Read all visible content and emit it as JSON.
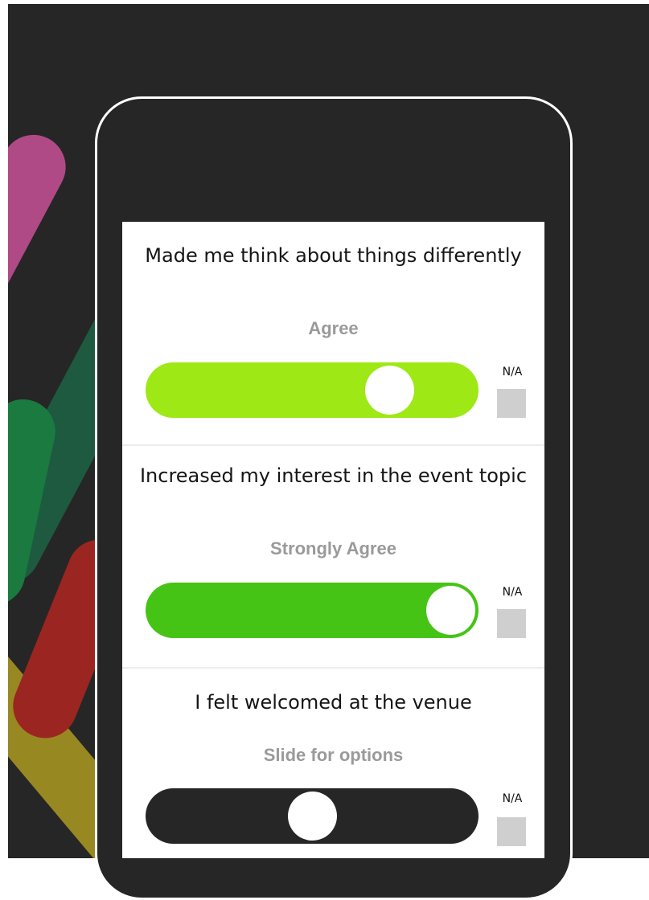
{
  "colors": {
    "background": "#262626",
    "phone_outline": "#ffffff",
    "slider_agree": "#9ee815",
    "slider_strongly_agree": "#45c416",
    "slider_neutral": "#262626",
    "na_box": "#cfcfcf",
    "answer_text": "#9a9a9a"
  },
  "survey": {
    "questions": [
      {
        "question": "Made me think about things differently",
        "answer": "Agree",
        "slider_level": 0.78,
        "na_label": "N/A",
        "na_checked": false
      },
      {
        "question": "Increased my interest in the event topic",
        "answer": "Strongly Agree",
        "slider_level": 1.0,
        "na_label": "N/A",
        "na_checked": false
      },
      {
        "question": "I felt welcomed at the venue",
        "answer": "Slide for options",
        "slider_level": 0.5,
        "na_label": "N/A",
        "na_checked": false
      }
    ]
  }
}
